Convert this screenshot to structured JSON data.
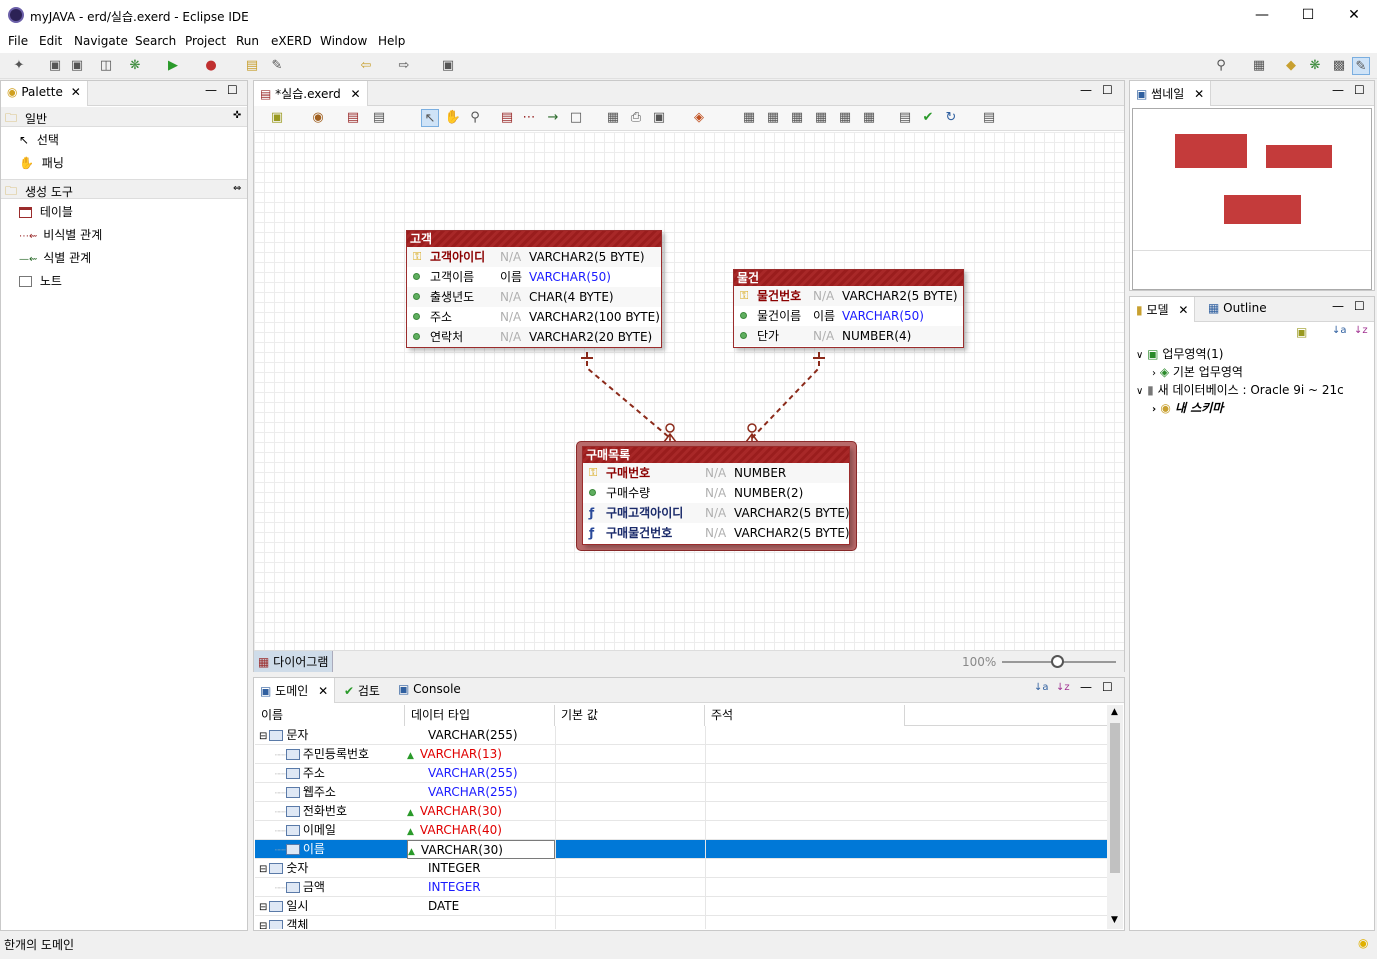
{
  "window": {
    "title": "myJAVA - erd/실습.exerd - Eclipse IDE"
  },
  "menu": [
    "File",
    "Edit",
    "Navigate",
    "Search",
    "Project",
    "Run",
    "eXERD",
    "Window",
    "Help"
  ],
  "palette": {
    "tab": "Palette",
    "groups": [
      {
        "label": "일반",
        "items": [
          "선택",
          "패닝"
        ]
      },
      {
        "label": "생성 도구",
        "items": [
          "테이블",
          "비식별 관계",
          "식별 관계",
          "노트"
        ]
      }
    ]
  },
  "editor": {
    "tab": "*실습.exerd",
    "bottom_tab": "다이어그램",
    "zoom": "100%"
  },
  "entities": {
    "customer": {
      "name": "고객",
      "rows": [
        {
          "name": "고객아이디",
          "def": "N/A",
          "type": "VARCHAR2(5 BYTE)",
          "kind": "pk"
        },
        {
          "name": "고객이름",
          "def": "이름",
          "type": "VARCHAR(50)",
          "kind": "attr",
          "typeColor": "blue"
        },
        {
          "name": "출생년도",
          "def": "N/A",
          "type": "CHAR(4 BYTE)",
          "kind": "attr"
        },
        {
          "name": "주소",
          "def": "N/A",
          "type": "VARCHAR2(100 BYTE)",
          "kind": "attr"
        },
        {
          "name": "연락처",
          "def": "N/A",
          "type": "VARCHAR2(20 BYTE)",
          "kind": "attr"
        }
      ]
    },
    "product": {
      "name": "물건",
      "rows": [
        {
          "name": "물건번호",
          "def": "N/A",
          "type": "VARCHAR2(5 BYTE)",
          "kind": "pk"
        },
        {
          "name": "물건이름",
          "def": "이름",
          "type": "VARCHAR(50)",
          "kind": "attr",
          "typeColor": "blue"
        },
        {
          "name": "단가",
          "def": "N/A",
          "type": "NUMBER(4)",
          "kind": "attr"
        }
      ]
    },
    "purchase": {
      "name": "구매목록",
      "rows": [
        {
          "name": "구매번호",
          "def": "N/A",
          "type": "NUMBER",
          "kind": "pk"
        },
        {
          "name": "구매수량",
          "def": "N/A",
          "type": "NUMBER(2)",
          "kind": "attr"
        },
        {
          "name": "구매고객아이디",
          "def": "N/A",
          "type": "VARCHAR2(5 BYTE)",
          "kind": "fk"
        },
        {
          "name": "구매물건번호",
          "def": "N/A",
          "type": "VARCHAR2(5 BYTE)",
          "kind": "fk"
        }
      ]
    }
  },
  "thumbnail": {
    "tab": "썸네일"
  },
  "model": {
    "tabs": [
      "모델",
      "Outline"
    ],
    "tree": [
      "업무영역(1)",
      "기본 업무영역",
      "새 데이터베이스 : Oracle 9i ~ 21c",
      "내 스키마"
    ]
  },
  "bottom": {
    "tabs": [
      "도메인",
      "검토",
      "Console"
    ],
    "columns": [
      "이름",
      "데이터 타입",
      "기본 값",
      "주석"
    ],
    "rows": [
      {
        "name": "문자",
        "type": "VARCHAR(255)",
        "level": 0,
        "color": "black",
        "warn": false
      },
      {
        "name": "주민등록번호",
        "type": "VARCHAR(13)",
        "level": 1,
        "color": "red",
        "warn": true
      },
      {
        "name": "주소",
        "type": "VARCHAR(255)",
        "level": 1,
        "color": "blue",
        "warn": false
      },
      {
        "name": "웹주소",
        "type": "VARCHAR(255)",
        "level": 1,
        "color": "blue",
        "warn": false
      },
      {
        "name": "전화번호",
        "type": "VARCHAR(30)",
        "level": 1,
        "color": "red",
        "warn": true
      },
      {
        "name": "이메일",
        "type": "VARCHAR(40)",
        "level": 1,
        "color": "red",
        "warn": true
      },
      {
        "name": "이름",
        "type": "VARCHAR(30)",
        "level": 1,
        "color": "black",
        "warn": true,
        "selected": true
      },
      {
        "name": "숫자",
        "type": "INTEGER",
        "level": 0,
        "color": "black",
        "warn": false
      },
      {
        "name": "금액",
        "type": "INTEGER",
        "level": 1,
        "color": "blue",
        "warn": false
      },
      {
        "name": "일시",
        "type": "DATE",
        "level": 0,
        "color": "black",
        "warn": false
      },
      {
        "name": "객체",
        "type": "",
        "level": 0,
        "color": "black",
        "warn": false
      }
    ]
  },
  "status": {
    "text": "한개의 도메인"
  }
}
